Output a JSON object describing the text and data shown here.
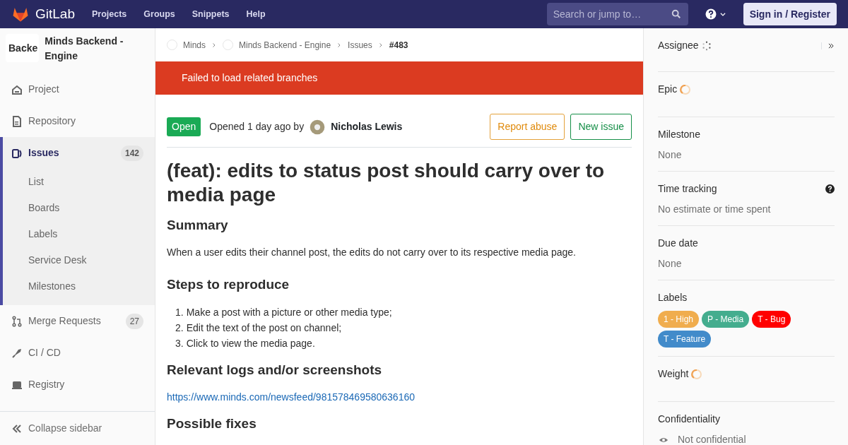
{
  "navbar": {
    "brand": "GitLab",
    "links": [
      "Projects",
      "Groups",
      "Snippets",
      "Help"
    ],
    "search": {
      "placeholder": "Search or jump to…"
    },
    "signin": "Sign in / Register"
  },
  "sidebar": {
    "project_avatar": "Backe",
    "project_name": "Minds Backend - Engine",
    "items": [
      {
        "label": "Project",
        "active": false
      },
      {
        "label": "Repository",
        "active": false
      },
      {
        "label": "Issues",
        "active": true,
        "count": "142",
        "children": [
          "List",
          "Boards",
          "Labels",
          "Service Desk",
          "Milestones"
        ]
      },
      {
        "label": "Merge Requests",
        "active": false,
        "count": "27"
      },
      {
        "label": "CI / CD",
        "active": false
      },
      {
        "label": "Registry",
        "active": false
      }
    ],
    "collapse": "Collapse sidebar"
  },
  "breadcrumbs": [
    {
      "label": "Minds",
      "avatar": true
    },
    {
      "label": "Minds Backend - Engine",
      "avatar": true
    },
    {
      "label": "Issues",
      "avatar": false
    },
    {
      "label": "#483",
      "avatar": false
    }
  ],
  "alert": "Failed to load related branches",
  "issue": {
    "status": "Open",
    "opened": "Opened 1 day ago by",
    "author": "Nicholas Lewis",
    "actions": [
      {
        "label": "Report abuse",
        "kind": "warning"
      },
      {
        "label": "New issue",
        "kind": "success"
      }
    ],
    "title": "(feat): edits to status post should carry over to media page",
    "sections": [
      {
        "heading": "Summary",
        "kind": "paragraph",
        "text": "When a user edits their channel post, the edits do not carry over to its respective media page."
      },
      {
        "heading": "Steps to reproduce",
        "kind": "list",
        "items": [
          {
            "marker": "1.",
            "text": "Make a post with a picture or other media type;"
          },
          {
            "marker": "2.",
            "text": "Edit the text of the post on channel;"
          },
          {
            "marker": "3.",
            "text": "Click to view the media page."
          }
        ]
      },
      {
        "heading": "Relevant logs and/or screenshots",
        "kind": "link",
        "text": "https://www.minds.com/newsfeed/981578469580636160"
      },
      {
        "heading": "Possible fixes",
        "kind": "heading"
      }
    ]
  },
  "right_sidebar": [
    {
      "title": "Assignee",
      "kind": "dots"
    },
    {
      "title": "Epic",
      "kind": "loading"
    },
    {
      "title": "Milestone",
      "kind": "text",
      "value": "None"
    },
    {
      "title": "Time tracking",
      "kind": "time",
      "value": "No estimate or time spent"
    },
    {
      "title": "Due date",
      "kind": "text",
      "value": "None"
    },
    {
      "title": "Labels",
      "kind": "labels",
      "labels": [
        {
          "label": "1 - High",
          "color": "#f0ad4e"
        },
        {
          "label": "P - Media",
          "color": "#44ad8e"
        },
        {
          "label": "T - Bug",
          "color": "#ff0000"
        },
        {
          "label": "T - Feature",
          "color": "#428bca"
        }
      ]
    },
    {
      "title": "Weight",
      "kind": "loading"
    },
    {
      "title": "Confidentiality",
      "kind": "confidential",
      "value": "Not confidential"
    }
  ]
}
